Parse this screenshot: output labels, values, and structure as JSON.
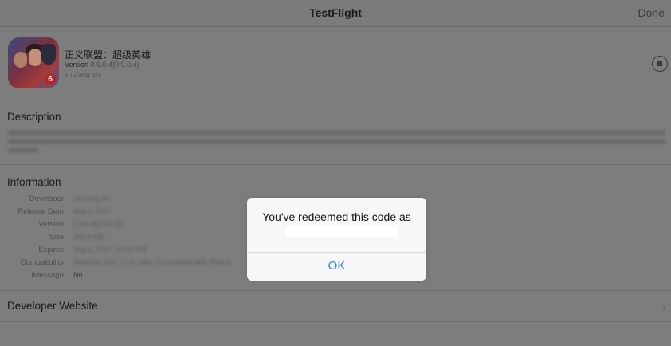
{
  "navbar": {
    "title": "TestFlight",
    "done_label": "Done"
  },
  "app": {
    "name": "正义联盟：超级英雄",
    "version_label": "Version",
    "version_value": "0.9.0.4(0.9.0.4)",
    "developer": "shufang shi",
    "icon": "app-icon-superheroes",
    "badge": "6"
  },
  "description": {
    "title": "Description"
  },
  "information": {
    "title": "Information",
    "rows": [
      {
        "label": "Developer",
        "value": "shufang shi"
      },
      {
        "label": "Release Date",
        "value": "Aug 2, 2017"
      },
      {
        "label": "Version",
        "value": "0.9.0.4(0.9.0.4)"
      },
      {
        "label": "Size",
        "value": "293.6 MB"
      },
      {
        "label": "Expires",
        "value": "Sep 2, 2017, 10:09 PM"
      },
      {
        "label": "Compatibility",
        "value": "Requires iOS 7.0 or later. Compatible with iPhone"
      },
      {
        "label": "iMessage",
        "value": "No"
      }
    ]
  },
  "developer_website": {
    "label": "Developer Website",
    "icon": "chevron-right-icon",
    "chevron": "›"
  },
  "alert": {
    "message": "You've redeemed this code as",
    "ok_label": "OK"
  },
  "colors": {
    "accent": "#2a7ff0",
    "dim_background": "#7d7d7d"
  }
}
